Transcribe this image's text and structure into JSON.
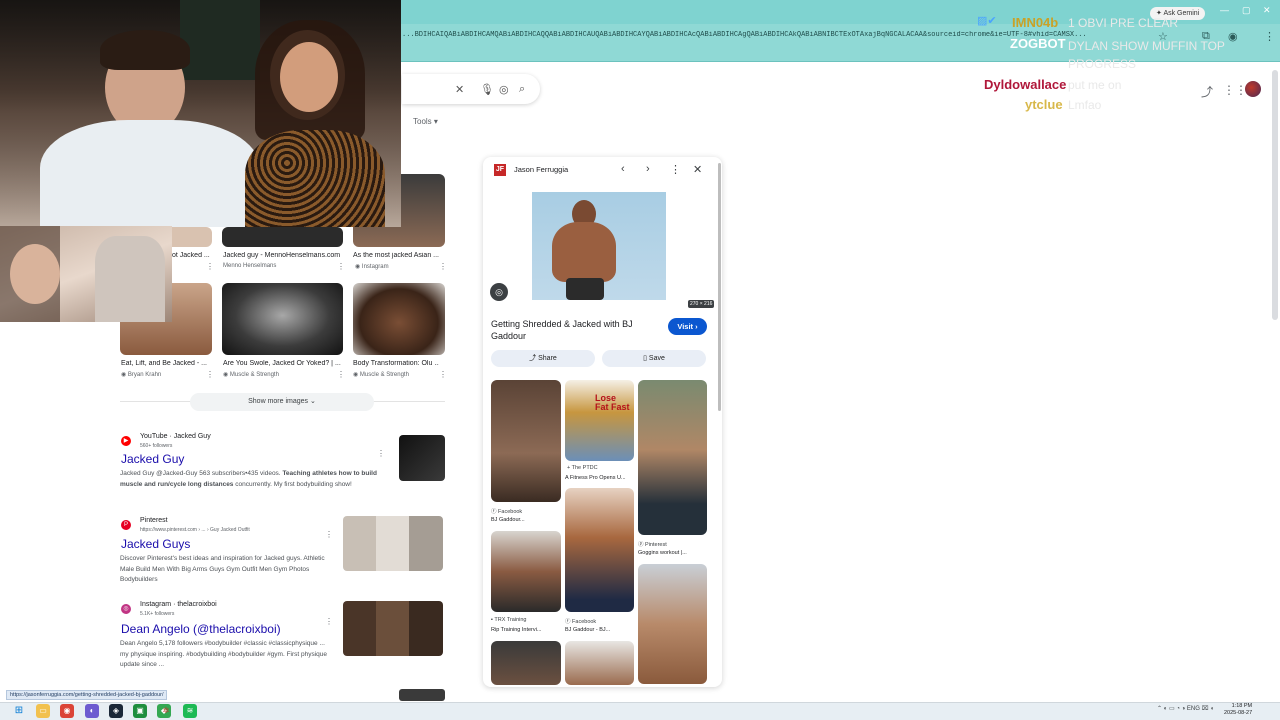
{
  "browser": {
    "url": "...BDIHCAIQABiABDIHCAMQABiABDIHCAQQABiABDIHCAUQABiABDIHCAYQABiABDIHCAcQABiABDIHCAgQABiABDIHCAkQABiABNIBCTExOTAxajBqNGCALACAA&sourceid=chrome&ie=UTF-8#vhid=CAMSX...",
    "ask_gemini": "Ask Gemini",
    "status_url": "https://jasonferruggia.com/getting-shredded-jacked-bj-gaddour/"
  },
  "search": {
    "tools_label": "Tools"
  },
  "chat": [
    {
      "user": "IMN04b",
      "message": "1 OBVI PRE CLEAR",
      "color": "#c9a227"
    },
    {
      "user": "ZOGBOT",
      "message": "DYLAN SHOW MUFFIN TOP PROGRESS",
      "color": "#ffffff"
    },
    {
      "user": "Dyldowallace",
      "message": "put me on",
      "color": "#b0173a"
    },
    {
      "user": "ytclue",
      "message": "Lmfao",
      "color": "#d8b84a"
    }
  ],
  "image_results": {
    "row1": [
      {
        "caption": "ot Jacked ...",
        "source": ""
      },
      {
        "caption": "Jacked guy - MennoHenselmans.com",
        "source": "Menno Henselmans"
      },
      {
        "caption": "As the most jacked Asian ...",
        "source": "Instagram"
      }
    ],
    "row2": [
      {
        "caption": "Eat, Lift, and Be Jacked - ...",
        "source": "Bryan Krahn"
      },
      {
        "caption": "Are You Swole, Jacked Or Yoked? | ...",
        "source": "Muscle & Strength"
      },
      {
        "caption": "Body Transformation: Olu ...",
        "source": "Muscle & Strength"
      }
    ],
    "show_more": "Show more images"
  },
  "web_results": [
    {
      "site": "YouTube · Jacked Guy",
      "sub": "560+ followers",
      "title": "Jacked Guy",
      "desc_bold": "Teaching athletes how to build muscle and run/cycle long distances",
      "desc": "Jacked Guy @Jacked-Guy 563 subscribers•435 videos. Teaching athletes how to build muscle and run/cycle long distances concurrently. My first bodybuilding show!"
    },
    {
      "site": "Pinterest",
      "sub": "https://www.pinterest.com › ... › Guy Jacked Outfit",
      "title": "Jacked Guys",
      "desc": "Discover Pinterest's best ideas and inspiration for Jacked guys. Athletic Male Build Men With Big Arms Guys Gym Outfit Men Gym Photos Bodybuilders"
    },
    {
      "site": "Instagram · thelacroixboi",
      "sub": "5.1K+ followers",
      "title": "Dean Angelo (@thelacroixboi)",
      "desc": "Dean Angelo 5,178 followers #bodybuilder #classic #classicphysique ... my physique inspiring. #bodybuilding #bodybuilder #gym. First physique update since ..."
    }
  ],
  "side_panel": {
    "source": "Jason Ferruggia",
    "logo": "JF",
    "dimensions": "270 × 216",
    "title": "Getting Shredded & Jacked with BJ Gaddour",
    "visit": "Visit",
    "share": "Share",
    "save": "Save",
    "related": [
      {
        "src": "Facebook",
        "caption": "BJ Gaddour..."
      },
      {
        "src": "The PTDC",
        "caption": "A Fitness Pro Opens U..."
      },
      {
        "src": "Pinterest",
        "caption": "Goggins workout |..."
      },
      {
        "src": "TRX Training",
        "caption": "Rip Training Intervi..."
      },
      {
        "src": "Facebook",
        "caption": "BJ Gaddour - BJ..."
      }
    ],
    "magazine_text": "Lose Fat Fast"
  },
  "taskbar": {
    "lang": "ENG",
    "time": "1:18 PM",
    "date": "2025-08-27"
  }
}
